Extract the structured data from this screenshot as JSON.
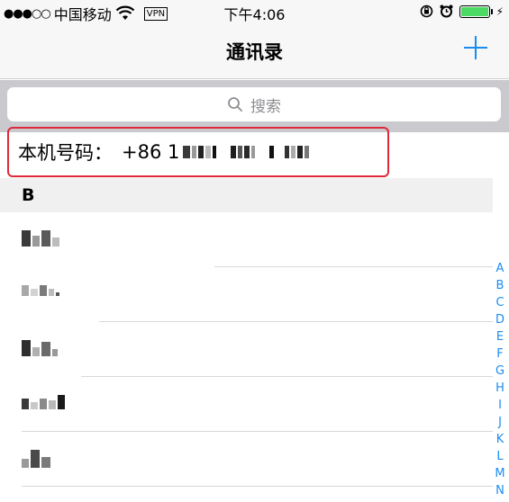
{
  "status_bar": {
    "signal": "●●●○○",
    "carrier": "中国移动",
    "vpn": "VPN",
    "time": "下午4:06",
    "battery_color": "#4cd964"
  },
  "nav": {
    "title": "通讯录",
    "add_icon": "plus-icon",
    "accent": "#1a8cf0"
  },
  "search": {
    "placeholder": "搜索",
    "icon": "search-icon"
  },
  "own_number": {
    "label": "本机号码：",
    "value_prefix": "+86 1",
    "highlight_color": "#e0283a"
  },
  "section": {
    "letter": "B"
  },
  "contacts": [
    {
      "name": ""
    },
    {
      "name": ""
    },
    {
      "name": ""
    },
    {
      "name": ""
    },
    {
      "name": ""
    }
  ],
  "index_letters": [
    "A",
    "B",
    "C",
    "D",
    "E",
    "F",
    "G",
    "H",
    "I",
    "J",
    "K",
    "L",
    "M",
    "N"
  ]
}
